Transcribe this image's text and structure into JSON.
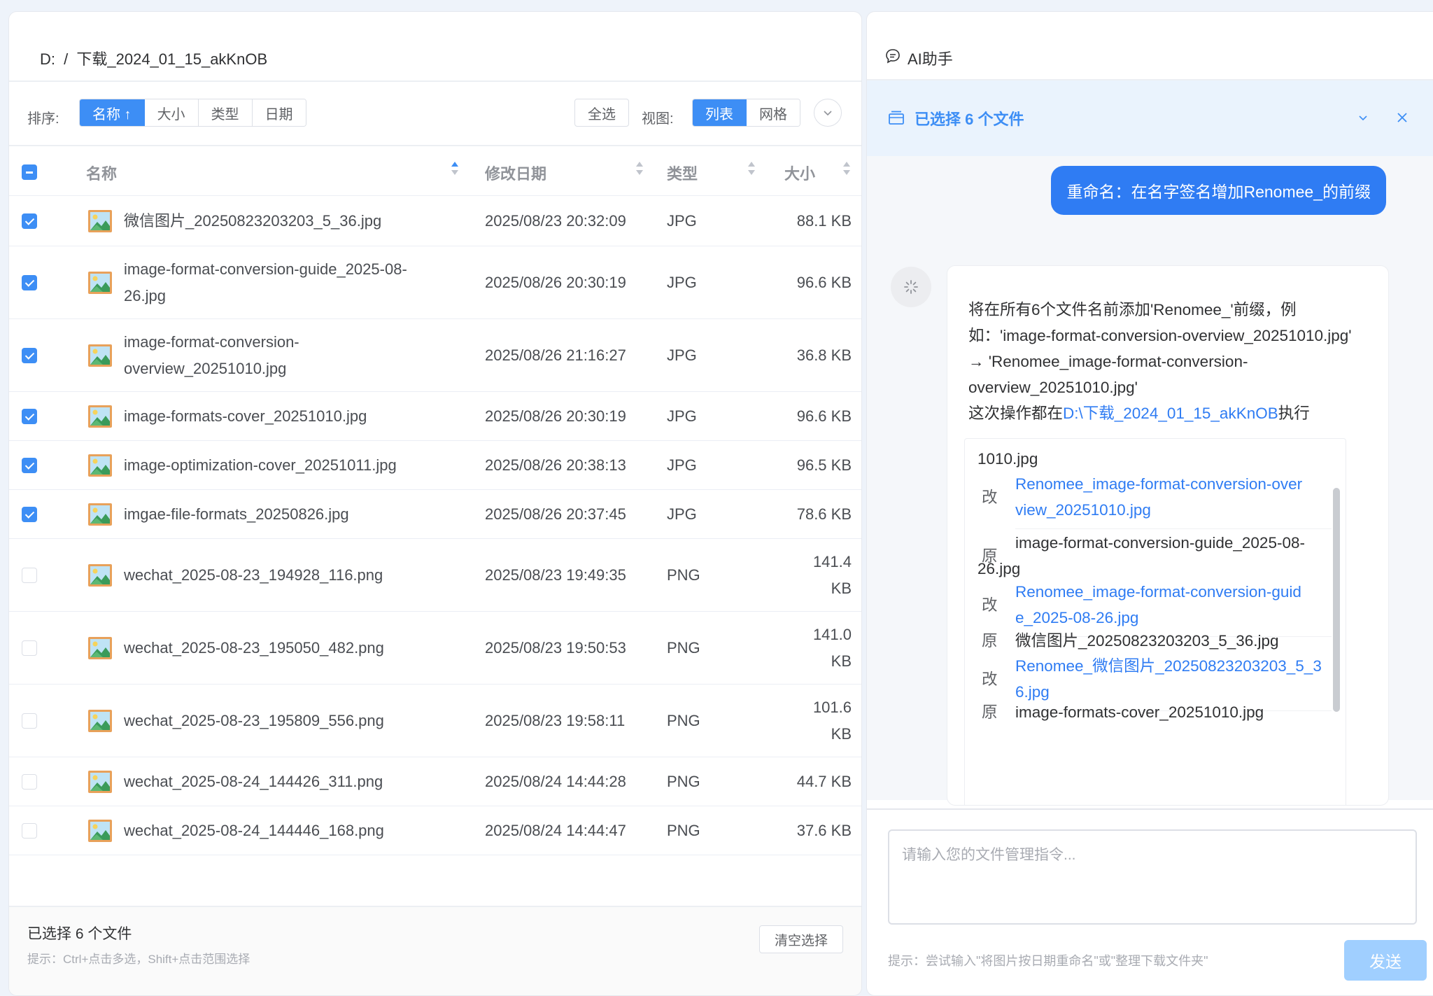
{
  "left": {
    "breadcrumb": {
      "drive": "D:",
      "sep": "/",
      "folder": "下载_2024_01_15_akKnOB"
    },
    "toolbar": {
      "sort_label": "排序:",
      "sort_options": [
        "名称 ↑",
        "大小",
        "类型",
        "日期"
      ],
      "sort_active": "名称",
      "select_all": "全选",
      "view_label": "视图:",
      "view_options": [
        "列表",
        "网格"
      ],
      "view_active": "列表"
    },
    "columns": {
      "name": "名称",
      "modified": "修改日期",
      "type": "类型",
      "size": "大小"
    },
    "rows": [
      {
        "name": "微信图片_20250823203203_5_36.jpg",
        "date": "2025/08/23 20:32:09",
        "type": "JPG",
        "size": "88.1 KB",
        "checked": true
      },
      {
        "name": "image-format-conversion-guide_2025-08-26.jpg",
        "date": "2025/08/26 20:30:19",
        "type": "JPG",
        "size": "96.6 KB",
        "checked": true
      },
      {
        "name": "image-format-conversion-overview_20251010.jpg",
        "date": "2025/08/26 21:16:27",
        "type": "JPG",
        "size": "36.8 KB",
        "checked": true
      },
      {
        "name": "image-formats-cover_20251010.jpg",
        "date": "2025/08/26 20:30:19",
        "type": "JPG",
        "size": "96.6 KB",
        "checked": true
      },
      {
        "name": "image-optimization-cover_20251011.jpg",
        "date": "2025/08/26 20:38:13",
        "type": "JPG",
        "size": "96.5 KB",
        "checked": true
      },
      {
        "name": "imgae-file-formats_20250826.jpg",
        "date": "2025/08/26 20:37:45",
        "type": "JPG",
        "size": "78.6 KB",
        "checked": true
      },
      {
        "name": "wechat_2025-08-23_194928_116.png",
        "date": "2025/08/23 19:49:35",
        "type": "PNG",
        "size": "141.4 KB",
        "checked": false
      },
      {
        "name": "wechat_2025-08-23_195050_482.png",
        "date": "2025/08/23 19:50:53",
        "type": "PNG",
        "size": "141.0 KB",
        "checked": false
      },
      {
        "name": "wechat_2025-08-23_195809_556.png",
        "date": "2025/08/23 19:58:11",
        "type": "PNG",
        "size": "101.6 KB",
        "checked": false
      },
      {
        "name": "wechat_2025-08-24_144426_311.png",
        "date": "2025/08/24 14:44:28",
        "type": "PNG",
        "size": "44.7 KB",
        "checked": false
      },
      {
        "name": "wechat_2025-08-24_144446_168.png",
        "date": "2025/08/24 14:44:47",
        "type": "PNG",
        "size": "37.6 KB",
        "checked": false
      }
    ],
    "footer": {
      "selected": "已选择 6 个文件",
      "tip": "提示：Ctrl+点击多选，Shift+点击范围选择",
      "clear": "清空选择"
    }
  },
  "right": {
    "title": "AI助手",
    "selection_bar": "已选择 6 个文件",
    "user_message": "重命名：在名字签名增加Renomee_的前缀",
    "ai_text_1": "将在所有6个文件名前添加'Renomee_'前缀，例如：'image-format-conversion-overview_20251010.jpg' → 'Renomee_image-format-conversion-overview_20251010.jpg'",
    "ai_text_2": "这次操作都在",
    "ai_path": "D:\\下载_2024_01_15_akKnOB",
    "ai_text_3": "执行",
    "rename_list": [
      {
        "tag": "",
        "value": "1010.jpg",
        "blue": false
      },
      {
        "tag": "改",
        "value": "Renomee_image-format-conversion-overview_20251010.jpg",
        "blue": true
      },
      {
        "tag": "原",
        "value": "image-format-conversion-guide_2025-08-26.jpg",
        "blue": false
      },
      {
        "tag": "改",
        "value": "Renomee_image-format-conversion-guide_2025-08-26.jpg",
        "blue": true
      },
      {
        "tag": "原",
        "value": "微信图片_20250823203203_5_36.jpg",
        "blue": false
      },
      {
        "tag": "改",
        "value": "Renomee_微信图片_20250823203203_5_36.jpg",
        "blue": true
      },
      {
        "tag": "原",
        "value": "image-formats-cover_20251010.jpg",
        "blue": false
      }
    ],
    "input_placeholder": "请输入您的文件管理指令...",
    "hint": "提示：尝试输入\"将图片按日期重命名\"或\"整理下载文件夹\"",
    "send": "发送"
  },
  "colors": {
    "accent": "#3d8ef5",
    "send_disabled": "#a0cfff",
    "selection_bg": "#eaf3fd"
  },
  "icons": [
    "chat-icon",
    "folder-icon",
    "chevron-down-icon",
    "close-icon",
    "image-file-icon",
    "loading-icon"
  ]
}
